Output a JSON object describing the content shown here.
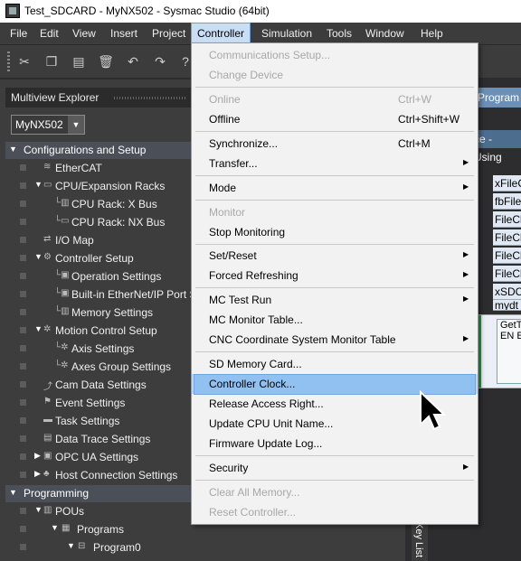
{
  "window": {
    "title": "Test_SDCARD - MyNX502 - Sysmac Studio (64bit)"
  },
  "menubar": {
    "items": [
      "File",
      "Edit",
      "View",
      "Insert",
      "Project",
      "Controller",
      "Simulation",
      "Tools",
      "Window",
      "Help"
    ],
    "active": "Controller"
  },
  "toolbar": {
    "icons": [
      "cut-icon",
      "copy-icon",
      "paste-icon",
      "delete-icon",
      "undo-icon",
      "redo-icon",
      "help-icon"
    ]
  },
  "explorer": {
    "title": "Multiview Explorer",
    "device": "MyNX502",
    "sections": {
      "config": "Configurations and Setup",
      "programming": "Programming"
    },
    "items": {
      "ethercat": "EtherCAT",
      "cpu_racks": "CPU/Expansion Racks",
      "cpu_rack_x": "CPU Rack: X Bus",
      "cpu_rack_nx": "CPU Rack: NX Bus",
      "io_map": "I/O Map",
      "controller_setup": "Controller Setup",
      "operation_settings": "Operation Settings",
      "ethernet_port": "Built-in EtherNet/IP Port S",
      "memory_settings": "Memory Settings",
      "motion_control": "Motion Control Setup",
      "axis_settings": "Axis Settings",
      "axes_group": "Axes Group Settings",
      "cam_data": "Cam Data Settings",
      "event_settings": "Event Settings",
      "task_settings": "Task Settings",
      "data_trace": "Data Trace Settings",
      "opc_ua": "OPC UA Settings",
      "host_connection": "Host Connection Settings",
      "pous": "POUs",
      "programs": "Programs",
      "program0": "Program0"
    }
  },
  "rightpane": {
    "tab": "Program",
    "header": "ce - Using",
    "cells": [
      "xFileC",
      "fbFile",
      "FileCl",
      "FileCl",
      "FileCl",
      "FileCl",
      "xSDC",
      "mydt"
    ],
    "fb_title": "GetT",
    "fb_pins": "EN  E",
    "key_list": "Key List"
  },
  "dropdown": {
    "items": {
      "comm_setup": "Communications Setup...",
      "change_device": "Change Device",
      "online": "Online",
      "online_sc": "Ctrl+W",
      "offline": "Offline",
      "offline_sc": "Ctrl+Shift+W",
      "synchronize": "Synchronize...",
      "synchronize_sc": "Ctrl+M",
      "transfer": "Transfer...",
      "mode": "Mode",
      "monitor": "Monitor",
      "stop_monitoring": "Stop Monitoring",
      "set_reset": "Set/Reset",
      "forced_refreshing": "Forced Refreshing",
      "mc_test_run": "MC Test Run",
      "mc_monitor_table": "MC Monitor Table...",
      "cnc_monitor_table": "CNC Coordinate System Monitor Table",
      "sd_memory_card": "SD Memory Card...",
      "controller_clock": "Controller Clock...",
      "release_access": "Release Access Right...",
      "update_cpu_name": "Update CPU Unit Name...",
      "firmware_log": "Firmware Update Log...",
      "security": "Security",
      "clear_memory": "Clear All Memory...",
      "reset_controller": "Reset Controller..."
    },
    "highlighted": "Controller Clock..."
  }
}
